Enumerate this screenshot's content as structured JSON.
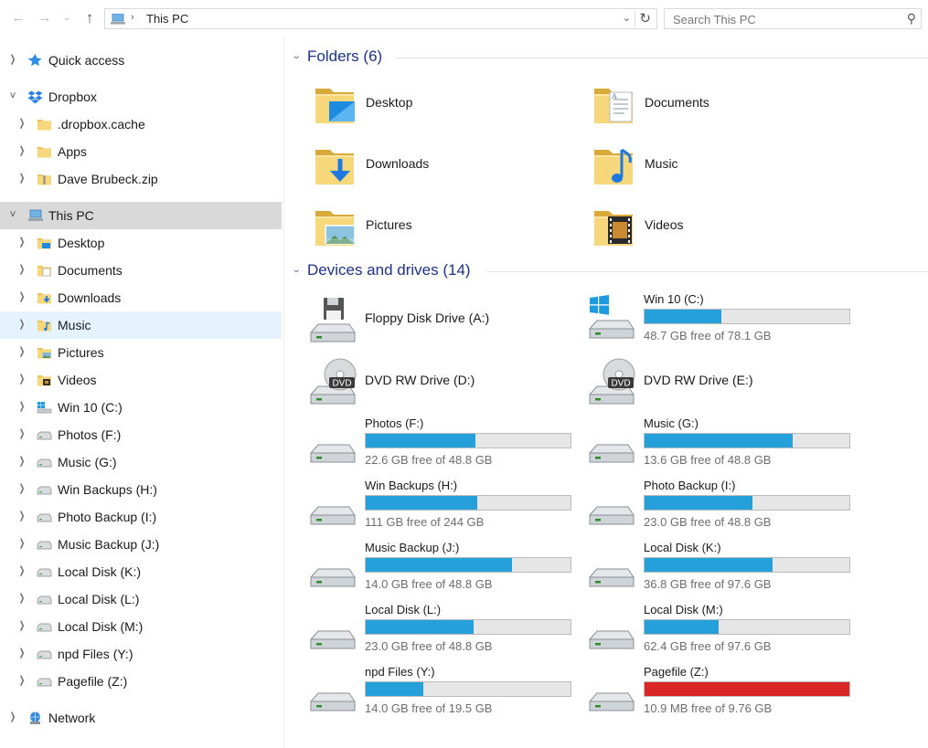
{
  "address": {
    "crumb": "This PC"
  },
  "search": {
    "placeholder": "Search This PC"
  },
  "nav": [
    {
      "label": "Quick access",
      "icon": "star-icon",
      "level": 0,
      "expanded": false
    },
    {
      "label": "Dropbox",
      "icon": "dropbox-icon",
      "level": 0,
      "expanded": true
    },
    {
      "label": ".dropbox.cache",
      "icon": "folder-icon",
      "level": 1
    },
    {
      "label": "Apps",
      "icon": "folder-icon",
      "level": 1
    },
    {
      "label": "Dave Brubeck.zip",
      "icon": "zip-folder-icon",
      "level": 1
    },
    {
      "label": "This PC",
      "icon": "this-pc-icon",
      "level": 0,
      "expanded": true,
      "selected": true
    },
    {
      "label": "Desktop",
      "icon": "desktop-folder-icon",
      "level": 1
    },
    {
      "label": "Documents",
      "icon": "documents-folder-icon",
      "level": 1
    },
    {
      "label": "Downloads",
      "icon": "downloads-folder-icon",
      "level": 1
    },
    {
      "label": "Music",
      "icon": "music-folder-icon",
      "level": 1,
      "hover": true
    },
    {
      "label": "Pictures",
      "icon": "pictures-folder-icon",
      "level": 1
    },
    {
      "label": "Videos",
      "icon": "videos-folder-icon",
      "level": 1
    },
    {
      "label": "Win 10 (C:)",
      "icon": "windows-drive-icon",
      "level": 1
    },
    {
      "label": "Photos (F:)",
      "icon": "drive-icon",
      "level": 1
    },
    {
      "label": "Music (G:)",
      "icon": "drive-icon",
      "level": 1
    },
    {
      "label": "Win Backups (H:)",
      "icon": "drive-icon",
      "level": 1
    },
    {
      "label": "Photo Backup (I:)",
      "icon": "drive-icon",
      "level": 1
    },
    {
      "label": "Music Backup (J:)",
      "icon": "drive-icon",
      "level": 1
    },
    {
      "label": "Local Disk (K:)",
      "icon": "drive-icon",
      "level": 1
    },
    {
      "label": "Local Disk (L:)",
      "icon": "drive-icon",
      "level": 1
    },
    {
      "label": "Local Disk (M:)",
      "icon": "drive-icon",
      "level": 1
    },
    {
      "label": "npd Files (Y:)",
      "icon": "drive-icon",
      "level": 1
    },
    {
      "label": "Pagefile (Z:)",
      "icon": "drive-icon",
      "level": 1
    },
    {
      "label": "Network",
      "icon": "network-icon",
      "level": 0,
      "expanded": false
    }
  ],
  "folders_group": {
    "title": "Folders (6)"
  },
  "folders": [
    {
      "name": "Desktop",
      "icon": "desktop-folder-icon"
    },
    {
      "name": "Documents",
      "icon": "documents-folder-icon"
    },
    {
      "name": "Downloads",
      "icon": "downloads-folder-icon"
    },
    {
      "name": "Music",
      "icon": "music-folder-icon"
    },
    {
      "name": "Pictures",
      "icon": "pictures-folder-icon"
    },
    {
      "name": "Videos",
      "icon": "videos-folder-icon"
    }
  ],
  "drives_group": {
    "title": "Devices and drives (14)"
  },
  "drives": [
    {
      "name": "Floppy Disk Drive (A:)",
      "icon": "floppy-drive-icon"
    },
    {
      "name": "Win 10 (C:)",
      "icon": "windows-drive-icon",
      "free": "48.7 GB free of 78.1 GB",
      "used_fraction": 0.376
    },
    {
      "name": "DVD RW Drive (D:)",
      "icon": "dvd-drive-icon"
    },
    {
      "name": "DVD RW Drive (E:)",
      "icon": "dvd-drive-icon"
    },
    {
      "name": "Photos (F:)",
      "icon": "drive-icon",
      "free": "22.6 GB free of 48.8 GB",
      "used_fraction": 0.537
    },
    {
      "name": "Music (G:)",
      "icon": "drive-icon",
      "free": "13.6 GB free of 48.8 GB",
      "used_fraction": 0.721
    },
    {
      "name": "Win Backups (H:)",
      "icon": "drive-icon",
      "free": "111 GB free of 244 GB",
      "used_fraction": 0.545
    },
    {
      "name": "Photo Backup (I:)",
      "icon": "drive-icon",
      "free": "23.0 GB free of 48.8 GB",
      "used_fraction": 0.529
    },
    {
      "name": "Music Backup (J:)",
      "icon": "drive-icon",
      "free": "14.0 GB free of 48.8 GB",
      "used_fraction": 0.713
    },
    {
      "name": "Local Disk (K:)",
      "icon": "drive-icon",
      "free": "36.8 GB free of 97.6 GB",
      "used_fraction": 0.623
    },
    {
      "name": "Local Disk (L:)",
      "icon": "drive-icon",
      "free": "23.0 GB free of 48.8 GB",
      "used_fraction": 0.529
    },
    {
      "name": "Local Disk (M:)",
      "icon": "drive-icon",
      "free": "62.4 GB free of 97.6 GB",
      "used_fraction": 0.361
    },
    {
      "name": "npd Files (Y:)",
      "icon": "drive-icon",
      "free": "14.0 GB free of 19.5 GB",
      "used_fraction": 0.282
    },
    {
      "name": "Pagefile (Z:)",
      "icon": "drive-icon",
      "free": "10.9 MB free of 9.76 GB",
      "used_fraction": 0.999,
      "critical": true
    }
  ],
  "colors": {
    "accent": "#26a0da",
    "critical": "#da2626",
    "group_title": "#1e3287",
    "selected_bg": "#d9d9d9",
    "hover_bg": "#e5f3ff"
  }
}
